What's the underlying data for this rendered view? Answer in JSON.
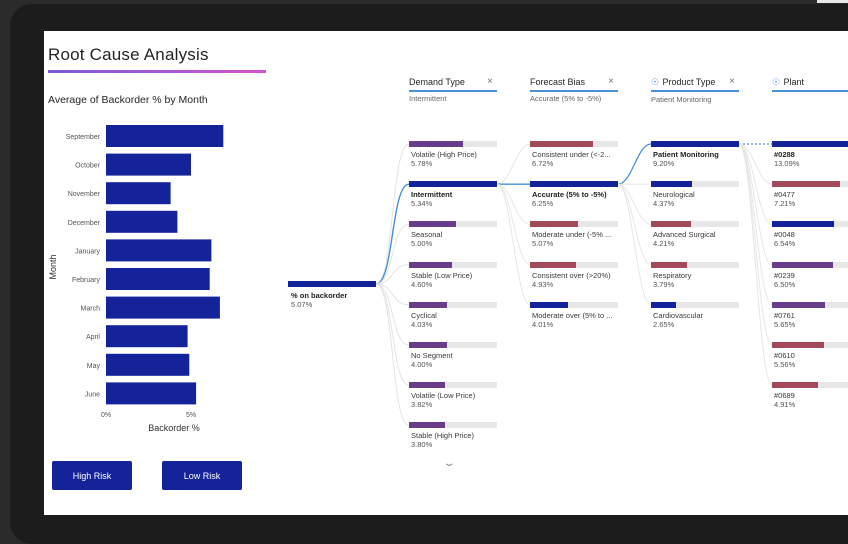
{
  "page": {
    "title": "Root Cause Analysis"
  },
  "colors": {
    "navy": "#14239a",
    "purple": "#6a3d8a",
    "rose": "#a34a5a",
    "link_blue": "#4a90d9",
    "track": "#e7e7e7"
  },
  "chart_data": {
    "type": "bar",
    "orientation": "horizontal",
    "title": "Average of Backorder % by Month",
    "xlabel": "Backorder %",
    "ylabel": "Month",
    "categories": [
      "September",
      "October",
      "November",
      "December",
      "January",
      "February",
      "March",
      "April",
      "May",
      "June"
    ],
    "values": [
      6.9,
      5.0,
      3.8,
      4.2,
      6.2,
      6.1,
      6.7,
      4.8,
      4.9,
      5.3
    ],
    "x_ticks": [
      "0%",
      "5%"
    ],
    "xlim": [
      0,
      8
    ],
    "bar_color": "#14239a",
    "grid": false
  },
  "buttons": {
    "high_risk": "High Risk",
    "low_risk": "Low Risk"
  },
  "tree": {
    "root": {
      "label": "% on backorder",
      "value": "5.07%"
    },
    "columns": [
      {
        "name": "Demand Type",
        "selected": "Intermittent",
        "icon": "close-icon",
        "items": [
          {
            "label": "Volatile (High Price)",
            "value": "5.78%",
            "pct": 5.78,
            "color": "purple"
          },
          {
            "label": "Intermittent",
            "value": "5.34%",
            "pct": 5.34,
            "color": "navy",
            "selected": true
          },
          {
            "label": "Seasonal",
            "value": "5.00%",
            "pct": 5.0,
            "color": "purple"
          },
          {
            "label": "Stable (Low Price)",
            "value": "4.60%",
            "pct": 4.6,
            "color": "purple"
          },
          {
            "label": "Cyclical",
            "value": "4.03%",
            "pct": 4.03,
            "color": "purple"
          },
          {
            "label": "No Segment",
            "value": "4.00%",
            "pct": 4.0,
            "color": "purple"
          },
          {
            "label": "Volatile (Low Price)",
            "value": "3.82%",
            "pct": 3.82,
            "color": "purple"
          },
          {
            "label": "Stable (High Price)",
            "value": "3.80%",
            "pct": 3.8,
            "color": "purple"
          }
        ]
      },
      {
        "name": "Forecast Bias",
        "selected": "Accurate (5% to -5%)",
        "icon": "close-icon",
        "items": [
          {
            "label": "Consistent under (<-2...",
            "value": "6.72%",
            "pct": 6.72,
            "color": "rose"
          },
          {
            "label": "Accurate (5% to -5%)",
            "value": "6.25%",
            "pct": 6.25,
            "color": "navy",
            "selected": true
          },
          {
            "label": "Moderate under (-5% ...",
            "value": "5.07%",
            "pct": 5.07,
            "color": "rose"
          },
          {
            "label": "Consistent over (>20%)",
            "value": "4.93%",
            "pct": 4.93,
            "color": "rose"
          },
          {
            "label": "Moderate over (5% to ...",
            "value": "4.01%",
            "pct": 4.01,
            "color": "navy"
          }
        ]
      },
      {
        "name": "Product Type",
        "selected": "Patient Monitoring",
        "icon": "lightbulb-icon",
        "items": [
          {
            "label": "Patient Monitoring",
            "value": "9.20%",
            "pct": 9.2,
            "color": "navy",
            "selected": true
          },
          {
            "label": "Neurological",
            "value": "4.37%",
            "pct": 4.37,
            "color": "navy"
          },
          {
            "label": "Advanced Surgical",
            "value": "4.21%",
            "pct": 4.21,
            "color": "rose"
          },
          {
            "label": "Respiratory",
            "value": "3.79%",
            "pct": 3.79,
            "color": "rose"
          },
          {
            "label": "Cardiovascular",
            "value": "2.65%",
            "pct": 2.65,
            "color": "navy"
          }
        ]
      },
      {
        "name": "Plant",
        "selected": "",
        "icon": "lightbulb-icon",
        "items": [
          {
            "label": "#0288",
            "value": "13.09%",
            "pct": 13.09,
            "color": "navy",
            "selected": true
          },
          {
            "label": "#0477",
            "value": "7.21%",
            "pct": 7.21,
            "color": "rose"
          },
          {
            "label": "#0048",
            "value": "6.54%",
            "pct": 6.54,
            "color": "navy"
          },
          {
            "label": "#0239",
            "value": "6.50%",
            "pct": 6.5,
            "color": "purple"
          },
          {
            "label": "#0761",
            "value": "5.65%",
            "pct": 5.65,
            "color": "purple"
          },
          {
            "label": "#0610",
            "value": "5.56%",
            "pct": 5.56,
            "color": "rose"
          },
          {
            "label": "#0689",
            "value": "4.91%",
            "pct": 4.91,
            "color": "rose"
          }
        ]
      }
    ]
  }
}
